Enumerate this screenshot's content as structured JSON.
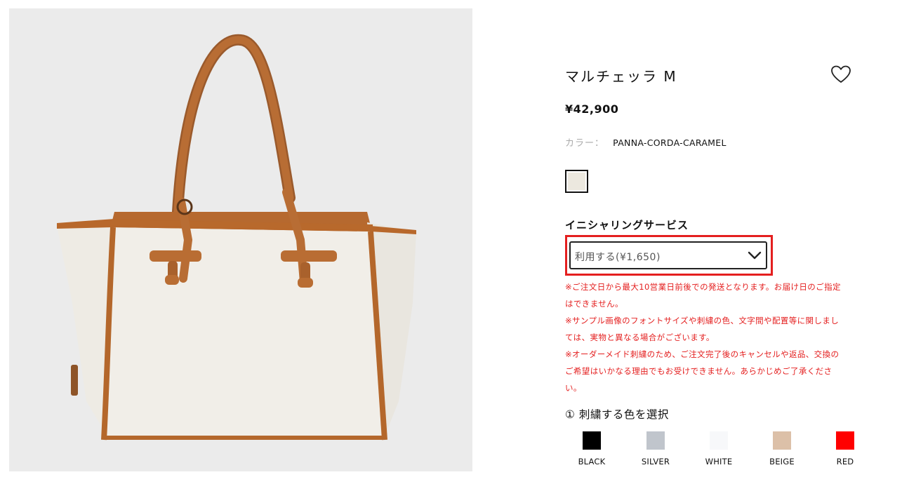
{
  "product": {
    "title": "マルチェッラ M",
    "price": "¥42,900",
    "color_label": "カラー：",
    "color_value": "PANNA-CORDA-CARAMEL",
    "favorite_icon": "heart-outline-icon",
    "swatch_color": "#ece8df"
  },
  "initialing": {
    "heading": "イニシャリングサービス",
    "selected_option": "利用する(¥1,650)",
    "dropdown_icon": "chevron-down-icon",
    "highlight_color": "#e41f1f",
    "notes": [
      "※ご注文日から最大10営業日前後での発送となります。お届け日のご指定",
      "はできません。",
      "※サンプル画像のフォントサイズや刺繍の色、文字間や配置等に関しまし",
      "ては、実物と異なる場合がございます。",
      "※オーダーメイド刺繍のため、ご注文完了後のキャンセルや返品、交換の",
      "ご希望はいかなる理由でもお受けできません。あらかじめご了承くださ",
      "い。"
    ]
  },
  "embroidery": {
    "step_label": "① 刺繍する色を選択",
    "colors": [
      {
        "name": "BLACK",
        "hex": "#000000"
      },
      {
        "name": "SILVER",
        "hex": "#c0c5cc"
      },
      {
        "name": "WHITE",
        "hex": "#f7f8fa"
      },
      {
        "name": "BEIGE",
        "hex": "#dcc0a8"
      },
      {
        "name": "RED",
        "hex": "#ff0000"
      }
    ]
  }
}
